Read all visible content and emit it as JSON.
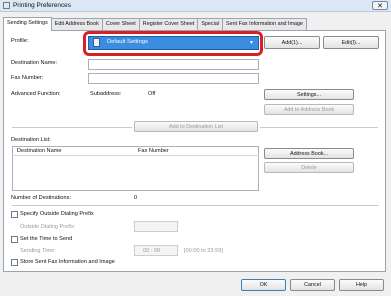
{
  "window": {
    "title": "Printing Preferences",
    "close_glyph": "✕"
  },
  "tabs": [
    {
      "label": "Sending Settings",
      "active": true
    },
    {
      "label": "Edit Address Book",
      "active": false
    },
    {
      "label": "Cover Sheet",
      "active": false
    },
    {
      "label": "Register Cover Sheet",
      "active": false
    },
    {
      "label": "Special",
      "active": false
    },
    {
      "label": "Sent Fax Information and Image",
      "active": false
    }
  ],
  "profile": {
    "label": "Profile:",
    "selected": "Default Settings",
    "add_button": "Add(1)...",
    "edit_button": "Edit(I)..."
  },
  "fields": {
    "destination_name_label": "Destination Name:",
    "fax_number_label": "Fax Number:",
    "advanced_function_label": "Advanced Function:",
    "subaddress_label": "Subaddress:",
    "subaddress_value": "Off"
  },
  "buttons": {
    "settings": "Settings...",
    "add_to_address_book": "Add to Address Book",
    "add_to_destination_list": "Add to Destination List",
    "address_book": "Address Book...",
    "delete": "Delete"
  },
  "destination_list": {
    "label": "Destination List:",
    "columns": [
      "Destination Name",
      "Fax Number"
    ],
    "rows": []
  },
  "destinations_count": {
    "label": "Number of Destinations:",
    "value": "0"
  },
  "options": {
    "outside_prefix_label": "Specify Outside Dialing Prefix",
    "outside_prefix_field_label": "Outside Dialing Prefix:",
    "set_time_label": "Set the Time to Send",
    "sending_time_label": "Sending Time:",
    "sending_time_value": "00 : 00",
    "sending_time_range": "[00:00 to 23:59]",
    "store_sent_label": "Store Sent Fax Information and Image"
  },
  "footer": {
    "ok": "OK",
    "cancel": "Cancel",
    "help": "Help"
  },
  "colors": {
    "accent": "#3b8de0",
    "highlight": "#d8202a"
  }
}
